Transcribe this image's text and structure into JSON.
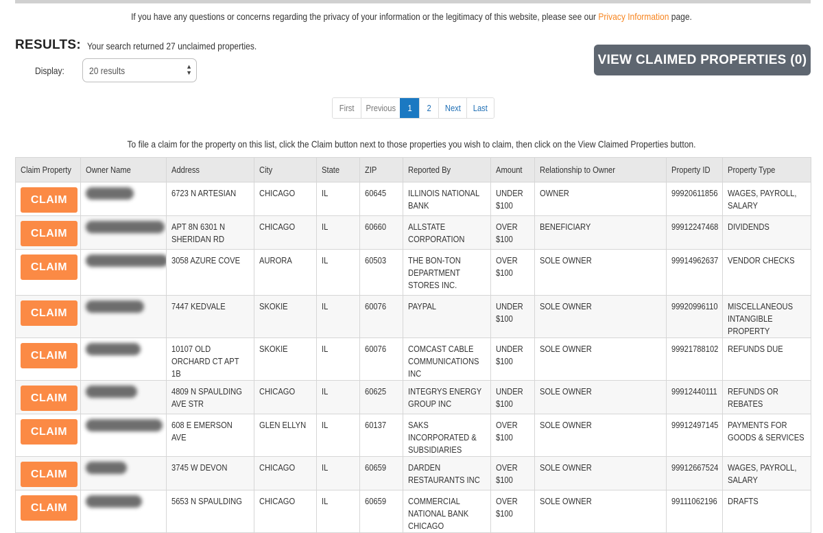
{
  "privacy": {
    "text_before": "If you have any questions or concerns regarding the privacy of your information or the legitimacy of this website, please see our",
    "link": "Privacy Information",
    "text_after": "page."
  },
  "results": {
    "label": "RESULTS:",
    "summary": "Your search returned 27 unclaimed properties.",
    "display_label": "Display:",
    "display_value": "20 results"
  },
  "view_claimed_label": "VIEW CLAIMED PROPERTIES (0)",
  "pagination": [
    {
      "label": "First",
      "state": "disabled"
    },
    {
      "label": "Previous",
      "state": "disabled"
    },
    {
      "label": "1",
      "state": "active"
    },
    {
      "label": "2",
      "state": "normal"
    },
    {
      "label": "Next",
      "state": "normal"
    },
    {
      "label": "Last",
      "state": "normal"
    }
  ],
  "instruction": "To file a claim for the property on this list, click the Claim button next to those properties you wish to claim, then click on the View Claimed Properties button.",
  "table": {
    "headers": [
      "Claim Property",
      "Owner Name",
      "Address",
      "City",
      "State",
      "ZIP",
      "Reported By",
      "Amount",
      "Relationship to Owner",
      "Property ID",
      "Property Type"
    ],
    "claim_label": "CLAIM",
    "rows": [
      {
        "owner": "redacted",
        "address": "6723 N ARTESIAN",
        "city": "CHICAGO",
        "state": "IL",
        "zip": "60645",
        "reported_by": "ILLINOIS NATIONAL BANK",
        "amount": "UNDER $100",
        "relationship": "OWNER",
        "property_id": "99920611856",
        "property_type": "WAGES, PAYROLL, SALARY"
      },
      {
        "owner": "redacted",
        "address": "APT 8N 6301 N SHERIDAN RD",
        "city": "CHICAGO",
        "state": "IL",
        "zip": "60660",
        "reported_by": "ALLSTATE CORPORATION",
        "amount": "OVER $100",
        "relationship": "BENEFICIARY",
        "property_id": "99912247468",
        "property_type": "DIVIDENDS"
      },
      {
        "owner": "redacted",
        "address": "3058 AZURE COVE",
        "city": "AURORA",
        "state": "IL",
        "zip": "60503",
        "reported_by": "THE BON-TON DEPARTMENT STORES INC.",
        "amount": "OVER $100",
        "relationship": "SOLE OWNER",
        "property_id": "99914962637",
        "property_type": "VENDOR CHECKS"
      },
      {
        "owner": "redacted",
        "address": "7447 KEDVALE",
        "city": "SKOKIE",
        "state": "IL",
        "zip": "60076",
        "reported_by": "PAYPAL",
        "amount": "UNDER $100",
        "relationship": "SOLE OWNER",
        "property_id": "99920996110",
        "property_type": "MISCELLANEOUS INTANGIBLE PROPERTY"
      },
      {
        "owner": "redacted",
        "address": "10107 OLD ORCHARD CT APT 1B",
        "city": "SKOKIE",
        "state": "IL",
        "zip": "60076",
        "reported_by": "COMCAST CABLE COMMUNICATIONS INC",
        "amount": "UNDER $100",
        "relationship": "SOLE OWNER",
        "property_id": "99921788102",
        "property_type": "REFUNDS DUE"
      },
      {
        "owner": "redacted",
        "address": "4809 N SPAULDING AVE STR",
        "city": "CHICAGO",
        "state": "IL",
        "zip": "60625",
        "reported_by": "INTEGRYS ENERGY GROUP INC",
        "amount": "UNDER $100",
        "relationship": "SOLE OWNER",
        "property_id": "99912440111",
        "property_type": "REFUNDS OR REBATES"
      },
      {
        "owner": "redacted",
        "address": "608 E EMERSON AVE",
        "city": "GLEN ELLYN",
        "state": "IL",
        "zip": "60137",
        "reported_by": "SAKS INCORPORATED & SUBSIDIARIES",
        "amount": "OVER $100",
        "relationship": "SOLE OWNER",
        "property_id": "99912497145",
        "property_type": "PAYMENTS FOR GOODS & SERVICES"
      },
      {
        "owner": "redacted",
        "address": "3745 W DEVON",
        "city": "CHICAGO",
        "state": "IL",
        "zip": "60659",
        "reported_by": "DARDEN RESTAURANTS INC",
        "amount": "OVER $100",
        "relationship": "SOLE OWNER",
        "property_id": "99912667524",
        "property_type": "WAGES, PAYROLL, SALARY"
      },
      {
        "owner": "redacted",
        "address": "5653 N SPAULDING",
        "city": "CHICAGO",
        "state": "IL",
        "zip": "60659",
        "reported_by": "COMMERCIAL NATIONAL BANK CHICAGO",
        "amount": "OVER $100",
        "relationship": "SOLE OWNER",
        "property_id": "99111062196",
        "property_type": "DRAFTS"
      }
    ]
  },
  "colors": {
    "claim_button": "#fb8a45",
    "view_claimed_button": "#5e6670",
    "active_page": "#1b79c2",
    "link": "#f7841e"
  }
}
